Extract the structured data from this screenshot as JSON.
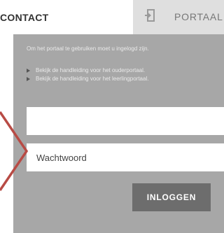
{
  "tabs": {
    "contact_label": "CONTACT",
    "portaal_label": "PORTAAL"
  },
  "login": {
    "intro": "Om het portaal te gebruiken moet u ingelogd zijn.",
    "links": [
      "Bekijk de handleiding voor het ouderportaal.",
      "Bekijk de handleiding voor het leerlingportaal."
    ],
    "username_value": "",
    "password_placeholder": "Wachtwoord",
    "submit_label": "INLOGGEN"
  },
  "icons": {
    "portaal_tab": "login-door-icon",
    "link_bullet": "triangle-right-icon",
    "annotation": "pointer-arrow-icon"
  },
  "colors": {
    "panel_bg": "#a7a7a7",
    "tab_inactive_bg": "#dfdfdf",
    "button_bg": "#6d6d6d",
    "annotation": "#b84b45"
  }
}
